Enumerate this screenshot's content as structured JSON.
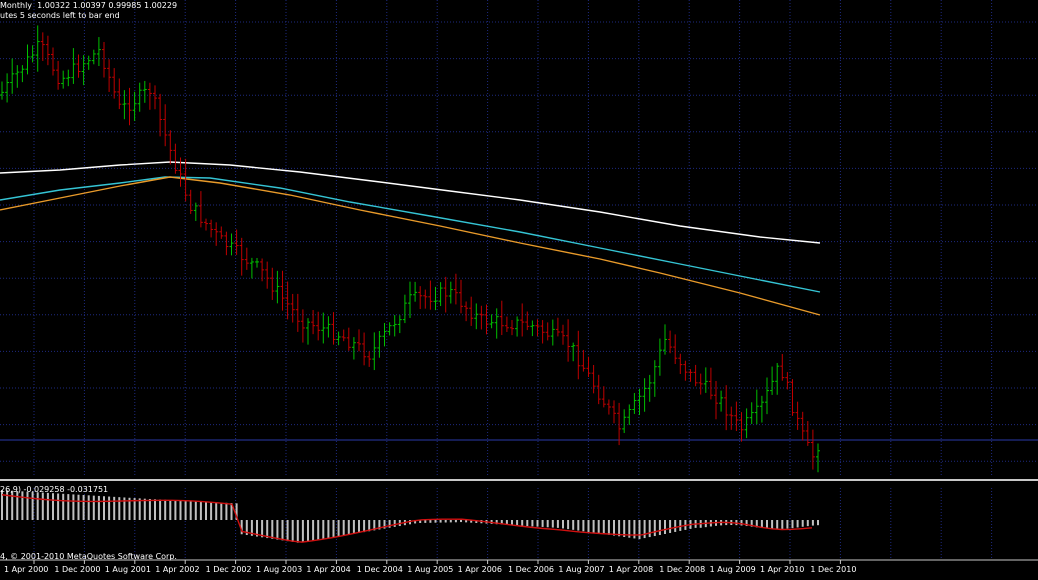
{
  "header": {
    "symbol_line": "Monthly  1.00322 1.00397 0.99985 1.00229",
    "timer_line": "utes 5 seconds left to bar end"
  },
  "indicator": {
    "label": "26,9) -0.029258 -0.031751",
    "copyright": "4, © 2001-2010 MetaQuotes Software Corp."
  },
  "x_axis_labels": [
    "1 Apr 2000",
    "1 Dec 2000",
    "1 Aug 2001",
    "1 Apr 2002",
    "1 Dec 2002",
    "1 Aug 2003",
    "1 Apr 2004",
    "1 Dec 2004",
    "1 Aug 2005",
    "1 Apr 2006",
    "1 Dec 2006",
    "1 Aug 2007",
    "1 Apr 2008",
    "1 Dec 2008",
    "1 Aug 2009",
    "1 Apr 2010",
    "1 Dec 2010"
  ],
  "colors": {
    "background": "#000000",
    "grid": "#1e2a80",
    "bull": "#00c000",
    "bear": "#c00000",
    "ma_slow": "#ffffff",
    "ma_mid": "#35c4d4",
    "ma_fast": "#e89a2a",
    "price_line": "#2a3aa8",
    "histogram": "#c0c0c0",
    "signal": "#d01010"
  }
}
